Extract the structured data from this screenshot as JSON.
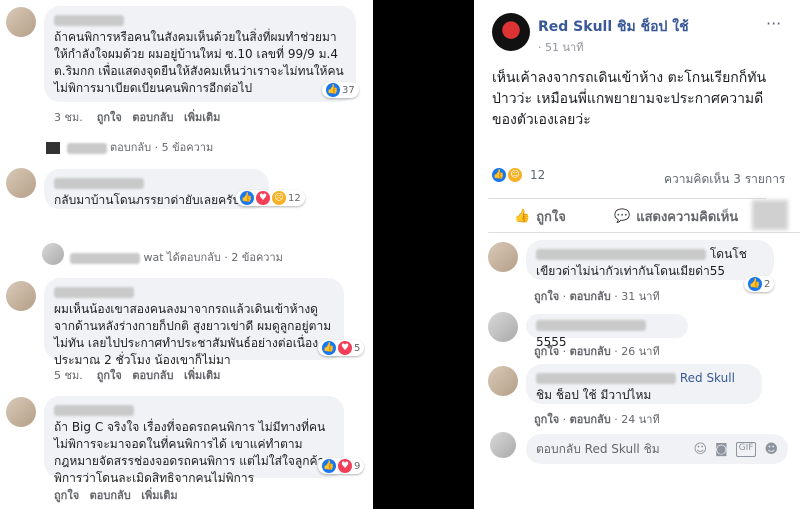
{
  "left": {
    "comments": [
      {
        "text": "ถ้าคนพิการหรือคนในสังคมเห็นด้วยในสิ่งที่ผมทำช่วยมาให้กำลังใจผมด้วย ผมอยู่บ้านใหม่ ซ.10 เลขที่ 99/9 ม.4 ต.ริมกก เพื่อแสดงจุดยืนให้สังคมเห็นว่าเราจะไม่ทนให้คนไม่พิการมาเบียดเบียนคนพิการอีกต่อไป",
        "time": "3 ชม.",
        "reactions": "37"
      },
      {
        "reply_text": "ตอบกลับ · 5 ข้อความ"
      },
      {
        "text": "กลับมาบ้านโดนภรรยาด่ายับเลยครับ",
        "reactions": "12"
      },
      {
        "reply_text": "wat ได้ตอบกลับ · 2 ข้อความ"
      },
      {
        "text": "ผมเห็นน้องเขาสองคนลงมาจากรถแล้วเดินเข้าห้างดูจากด้านหลังร่างกายก็ปกติ สูงยาวเข่าดี ผมดูลูกอยู่ตามไม่ทัน เลยไปประกาศทำประชาสัมพันธ์อย่างต่อเนื่องประมาณ 2 ชั่วโมง น้องเขาก็ไม่มา",
        "time": "5 ชม.",
        "reactions": "5"
      },
      {
        "text": "ถ้า Big C จริงใจ เรื่องที่จอดรถคนพิการ ไม่มีทางที่คนไม่พิการจะมาจอดในที่คนพิการได้ เขาแค่ทำตามกฎหมายจัดสรรช่องจอดรถคนพิการ แต่ไม่ใส่ใจลูกค้าพิการว่าโดนละเมิดสิทธิจากคนไม่พิการ",
        "reactions": "9"
      }
    ],
    "actions": {
      "like": "ถูกใจ",
      "reply": "ตอบกลับ",
      "more": "เพิ่มเติม"
    }
  },
  "right": {
    "page_name": "Red Skull ชิม ช็อป ใช้",
    "post_time": "51 นาที",
    "post_text": "เห็นเค้าลงจากรถเดินเข้าห้าง ตะโกนเรียกก็ทันป่าวว่ะ เหมือนพี่แกพยายามจะประกาศความดีของตัวเองเลยว่ะ",
    "reaction_count": "12",
    "comment_count": "ความคิดเห็น 3 รายการ",
    "like_action": "ถูกใจ",
    "comment_action": "แสดงความคิดเห็น",
    "comments": [
      {
        "text_suffix": "โดนโช",
        "text_line2": "เขียวด่าไม่น่ากัวเท่ากันโดนเมียด่า55",
        "time": "31 นาที",
        "reactions": "2"
      },
      {
        "text_suffix": "5555",
        "time": "26 นาที"
      },
      {
        "text_suffix": "Red Skull",
        "text_line2": "ชิม ช็อป ใช้ มีวาปไหม",
        "time": "24 นาที"
      }
    ],
    "actions": {
      "like": "ถูกใจ",
      "reply": "ตอบกลับ"
    },
    "reply_placeholder": "ตอบกลับ Red Skull ชิม"
  }
}
